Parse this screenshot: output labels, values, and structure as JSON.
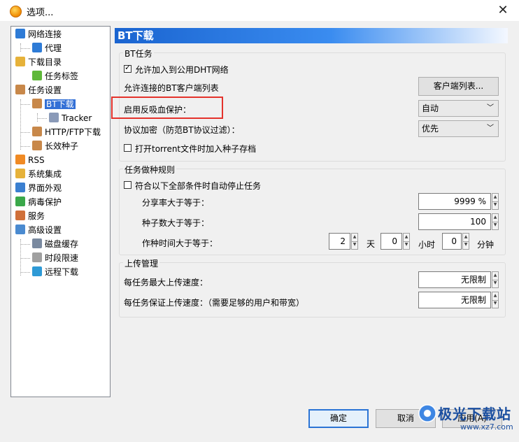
{
  "window": {
    "title": "选项..."
  },
  "tree": [
    {
      "label": "网络连接",
      "icon": "globe-icon",
      "color": "#2e7bd6"
    },
    {
      "label": "代理",
      "icon": "globe-icon",
      "color": "#2e7bd6"
    },
    {
      "label": "下载目录",
      "icon": "folder-icon",
      "color": "#e6b23a"
    },
    {
      "label": "任务标签",
      "icon": "tag-icon",
      "color": "#5fb83a"
    },
    {
      "label": "任务设置",
      "icon": "clipboard-icon",
      "color": "#c8884a"
    },
    {
      "label": "BT下载",
      "icon": "clipboard-icon",
      "color": "#c8884a",
      "selected": true
    },
    {
      "label": "Tracker",
      "icon": "cube-icon",
      "color": "#8a9ab8"
    },
    {
      "label": "HTTP/FTP下载",
      "icon": "clipboard-icon",
      "color": "#c8884a"
    },
    {
      "label": "长效种子",
      "icon": "clipboard-icon",
      "color": "#c8884a"
    },
    {
      "label": "RSS",
      "icon": "rss-icon",
      "color": "#f08a24"
    },
    {
      "label": "系统集成",
      "icon": "puzzle-icon",
      "color": "#e6b23a"
    },
    {
      "label": "界面外观",
      "icon": "palette-icon",
      "color": "#3a7fd0"
    },
    {
      "label": "病毒保护",
      "icon": "shield-icon",
      "color": "#3aa84a"
    },
    {
      "label": "服务",
      "icon": "people-icon",
      "color": "#d0703a"
    },
    {
      "label": "高级设置",
      "icon": "settings-icon",
      "color": "#4a8ad0"
    },
    {
      "label": "磁盘缓存",
      "icon": "disk-icon",
      "color": "#7a8aa0"
    },
    {
      "label": "时段限速",
      "icon": "key-icon",
      "color": "#a0a0a0"
    },
    {
      "label": "远程下载",
      "icon": "globe-icon",
      "color": "#2e9ad6"
    }
  ],
  "header": {
    "title": "BT下载"
  },
  "bt_group": {
    "title": "BT任务",
    "dht_label": "允许加入到公用DHT网络",
    "dht_checked": true,
    "clients_label": "允许连接的BT客户端列表",
    "clients_button": "客户端列表...",
    "anti_leech_label": "启用反吸血保护：",
    "anti_leech_value": "自动",
    "encryption_label": "协议加密（防范BT协议过滤）：",
    "encryption_value": "优先",
    "torrent_label": "打开torrent文件时加入种子存档",
    "torrent_checked": false
  },
  "seeding_group": {
    "title": "任务做种规则",
    "stop_label": "符合以下全部条件时自动停止任务",
    "stop_checked": false,
    "ratio_label": "分享率大于等于：",
    "ratio_value": "9999 %",
    "seeds_label": "种子数大于等于：",
    "seeds_value": "100",
    "time_label": "作种时间大于等于：",
    "days_value": "2",
    "days_unit": "天",
    "hours_value": "0",
    "hours_unit": "小时",
    "minutes_value": "0",
    "minutes_unit": "分钟"
  },
  "upload_group": {
    "title": "上传管理",
    "max_label": "每任务最大上传速度：",
    "max_value": "无限制",
    "guarantee_label": "每任务保证上传速度：（需要足够的用户和带宽）",
    "guarantee_value": "无限制"
  },
  "footer": {
    "ok": "确定",
    "cancel": "取消",
    "apply": "应用(A)"
  },
  "watermark": {
    "text": "极光下载站",
    "url": "www.xz7.com"
  }
}
